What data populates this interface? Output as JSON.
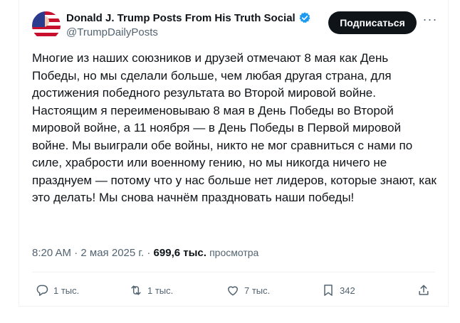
{
  "post": {
    "author_name": "Donald J. Trump Posts From His Truth Social",
    "author_handle": "@TrumpDailyPosts",
    "subscribe_label": "Подписаться",
    "more_label": "···",
    "text": "Многие из наших союзников и друзей отмечают 8 мая как День\nПобеды, но мы сделали больше, чем любая другая страна, для\nдостижения победного результата во Второй мировой войне.\nНастоящим я переименовываю 8 мая в День Победы во Второй\nмировой войне, а 11 ноября — в День Победы в Первой мировой\nвойне. Мы выиграли обе войны, никто не мог сравниться с нами по\nсиле, храбрости или военному гению, но мы никогда ничего не\nпразднуем — потому что у нас больше нет лидеров, которые знают, как\nэто делать! Мы снова начнём праздновать наши победы!",
    "time": "8:20 AM",
    "date": "2 мая 2025 г.",
    "views_count": "699,6 тыс.",
    "views_label": "просмотра"
  },
  "actions": {
    "replies": "1 тыс.",
    "reposts": "1 тыс.",
    "likes": "7 тыс.",
    "bookmarks": "342"
  },
  "icons": {
    "verified": "verified-badge-icon",
    "reply": "reply-icon",
    "repost": "repost-icon",
    "like": "heart-icon",
    "bookmark": "bookmark-icon",
    "share": "share-icon"
  },
  "colors": {
    "text": "#0f1419",
    "secondary": "#536471",
    "verified": "#1d9bf0",
    "button": "#0f1419"
  }
}
